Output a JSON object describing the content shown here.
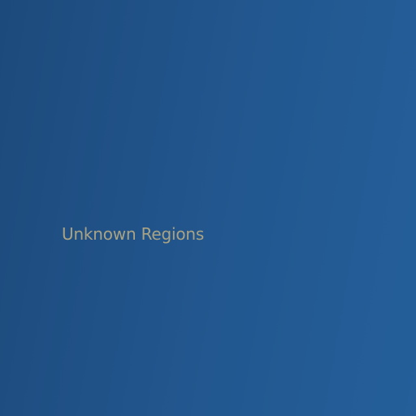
{
  "map": {
    "region_label": "Unknown Regions",
    "colors": {
      "background": "#20538a",
      "label_text": "#a9a384"
    }
  }
}
